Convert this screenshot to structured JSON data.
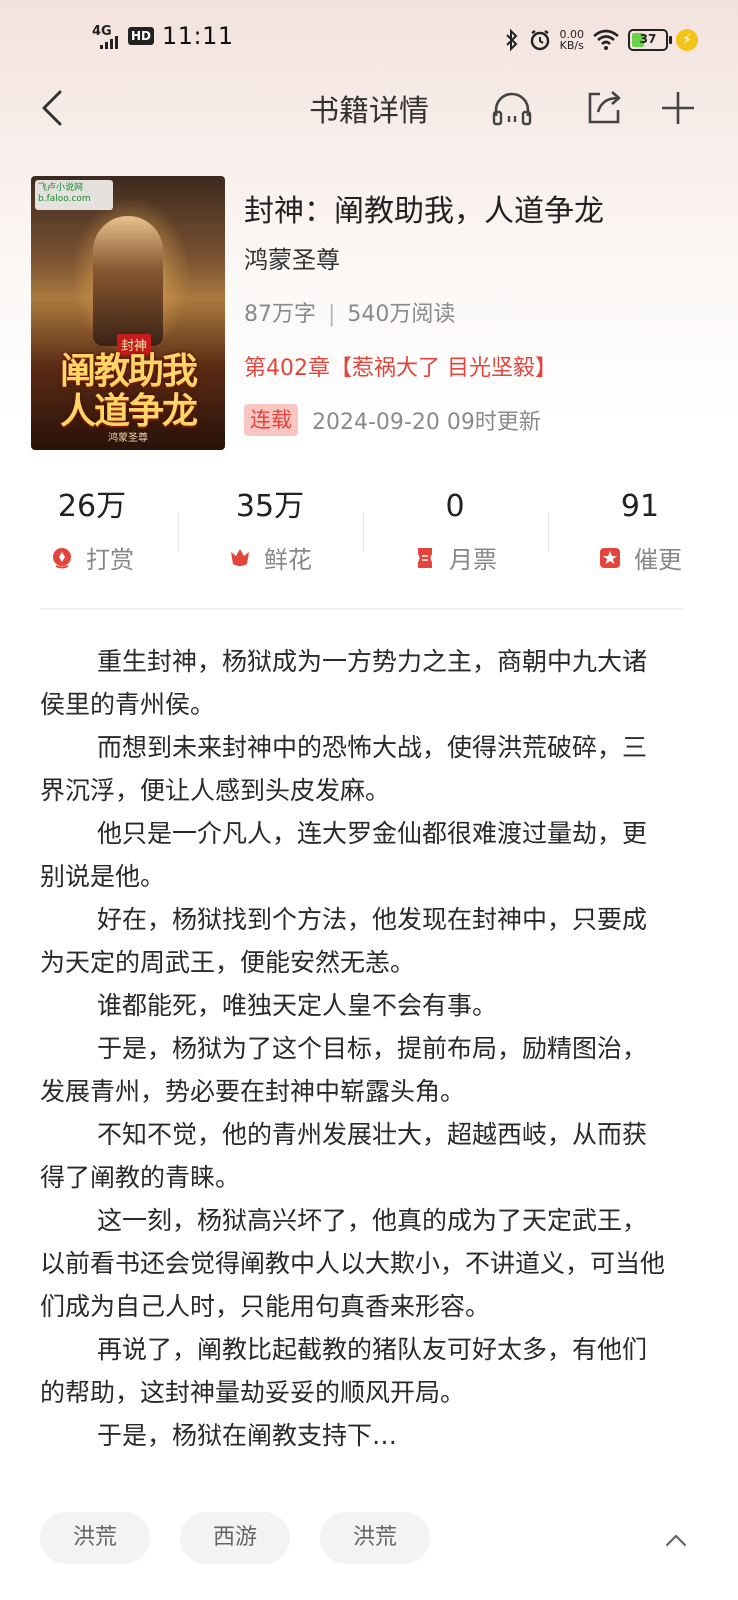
{
  "status_bar": {
    "network": "4G",
    "hd": "HD",
    "time": "11:11",
    "speed_value": "0.00",
    "speed_unit": "KB/s",
    "battery": "37",
    "battery_level": 0.37
  },
  "nav": {
    "title": "书籍详情",
    "icons": [
      "back-icon",
      "headphones-icon",
      "share-icon",
      "add-icon"
    ]
  },
  "book": {
    "cover": {
      "publisher_logo": "飞卢小说网",
      "publisher_sub": "b.faloo.com",
      "tag": "封神",
      "title_line1": "阐教助我",
      "title_line2": "人道争龙",
      "author": "鸿蒙圣尊"
    },
    "title": "封神：阐教助我，人道争龙",
    "author": "鸿蒙圣尊",
    "word_count": "87万字",
    "separator": "|",
    "reads": "540万阅读",
    "latest_chapter": "第402章【惹祸大了 目光坚毅】",
    "status": "连载",
    "update_time": "2024-09-20 09时更新"
  },
  "stats": [
    {
      "value": "26万",
      "label": "打赏",
      "icon": "reward-icon"
    },
    {
      "value": "35万",
      "label": "鲜花",
      "icon": "flower-icon"
    },
    {
      "value": "0",
      "label": "月票",
      "icon": "ticket-icon"
    },
    {
      "value": "91",
      "label": "催更",
      "icon": "urge-icon"
    }
  ],
  "description": [
    "重生封神，杨狱成为一方势力之主，商朝中九大诸侯里的青州侯。",
    "而想到未来封神中的恐怖大战，使得洪荒破碎，三界沉浮，便让人感到头皮发麻。",
    "他只是一介凡人，连大罗金仙都很难渡过量劫，更别说是他。",
    "好在，杨狱找到个方法，他发现在封神中，只要成为天定的周武王，便能安然无恙。",
    "谁都能死，唯独天定人皇不会有事。",
    "于是，杨狱为了这个目标，提前布局，励精图治，发展青州，势必要在封神中崭露头角。",
    "不知不觉，他的青州发展壮大，超越西岐，从而获得了阐教的青睐。",
    "这一刻，杨狱高兴坏了，他真的成为了天定武王，以前看书还会觉得阐教中人以大欺小，不讲道义，可当他们成为自己人时，只能用句真香来形容。",
    "再说了，阐教比起截教的猪队友可好太多，有他们的帮助，这封神量劫妥妥的顺风开局。",
    "于是，杨狱在阐教支持下…"
  ],
  "tags": [
    "洪荒",
    "西游",
    "洪荒"
  ],
  "colors": {
    "accent_red": "#e3453c",
    "badge_bg": "#f9c6c2",
    "muted": "#8a8a8a"
  }
}
